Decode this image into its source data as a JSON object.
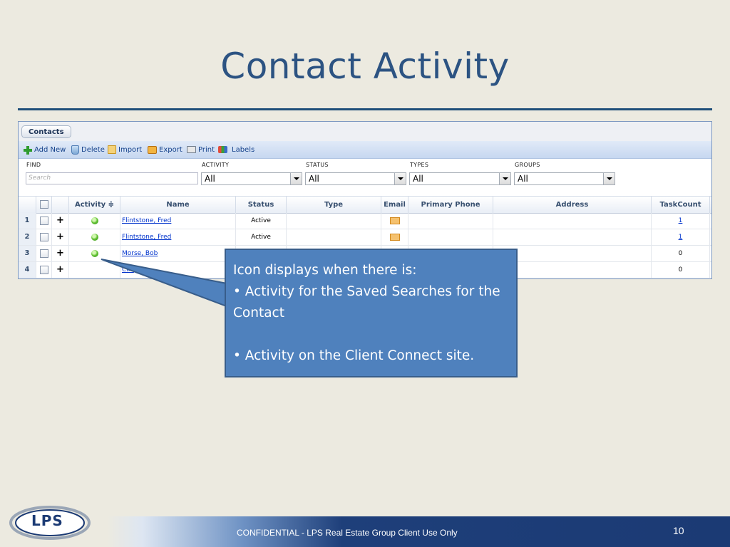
{
  "slide": {
    "title": "Contact Activity",
    "footer": "CONFIDENTIAL - LPS Real Estate Group Client Use Only",
    "page_number": "10",
    "logo_text": "LPS"
  },
  "app": {
    "tab_label": "Contacts",
    "toolbar": {
      "add_new": "Add New",
      "delete": "Delete",
      "import": "Import",
      "export": "Export",
      "print": "Print",
      "labels": "Labels"
    },
    "filters": {
      "find_label": "FIND",
      "search_placeholder": "Search",
      "activity_label": "ACTIVITY",
      "activity_value": "All",
      "status_label": "STATUS",
      "status_value": "All",
      "types_label": "TYPES",
      "types_value": "All",
      "groups_label": "GROUPS",
      "groups_value": "All"
    },
    "grid": {
      "headers": {
        "activity": "Activity ≑",
        "name": "Name",
        "status": "Status",
        "type": "Type",
        "email": "Email",
        "primary_phone": "Primary Phone",
        "address": "Address",
        "taskcount": "TaskCount"
      },
      "rows": [
        {
          "num": "1",
          "activity": true,
          "name": "Flintstone, Fred",
          "status": "Active",
          "email": true,
          "taskcount": "1",
          "task_link": true
        },
        {
          "num": "2",
          "activity": true,
          "name": "Flintstone, Fred",
          "status": "Active",
          "email": true,
          "taskcount": "1",
          "task_link": true
        },
        {
          "num": "3",
          "activity": true,
          "name": "Morse, Bob",
          "status": "",
          "email": false,
          "taskcount": "0",
          "task_link": false
        },
        {
          "num": "4",
          "activity": false,
          "name": "Clie",
          "status": "",
          "email": false,
          "taskcount": "0",
          "task_link": false
        }
      ]
    }
  },
  "callout": {
    "line1": "Icon displays when there is:",
    "line2": "• Activity for the Saved Searches for the Contact",
    "line3": "• Activity on the Client Connect  site."
  },
  "colors": {
    "title": "#2C5382",
    "callout_fill": "#4F81BD",
    "footer_band": "#1B3A74",
    "background": "#ECEAE0"
  }
}
